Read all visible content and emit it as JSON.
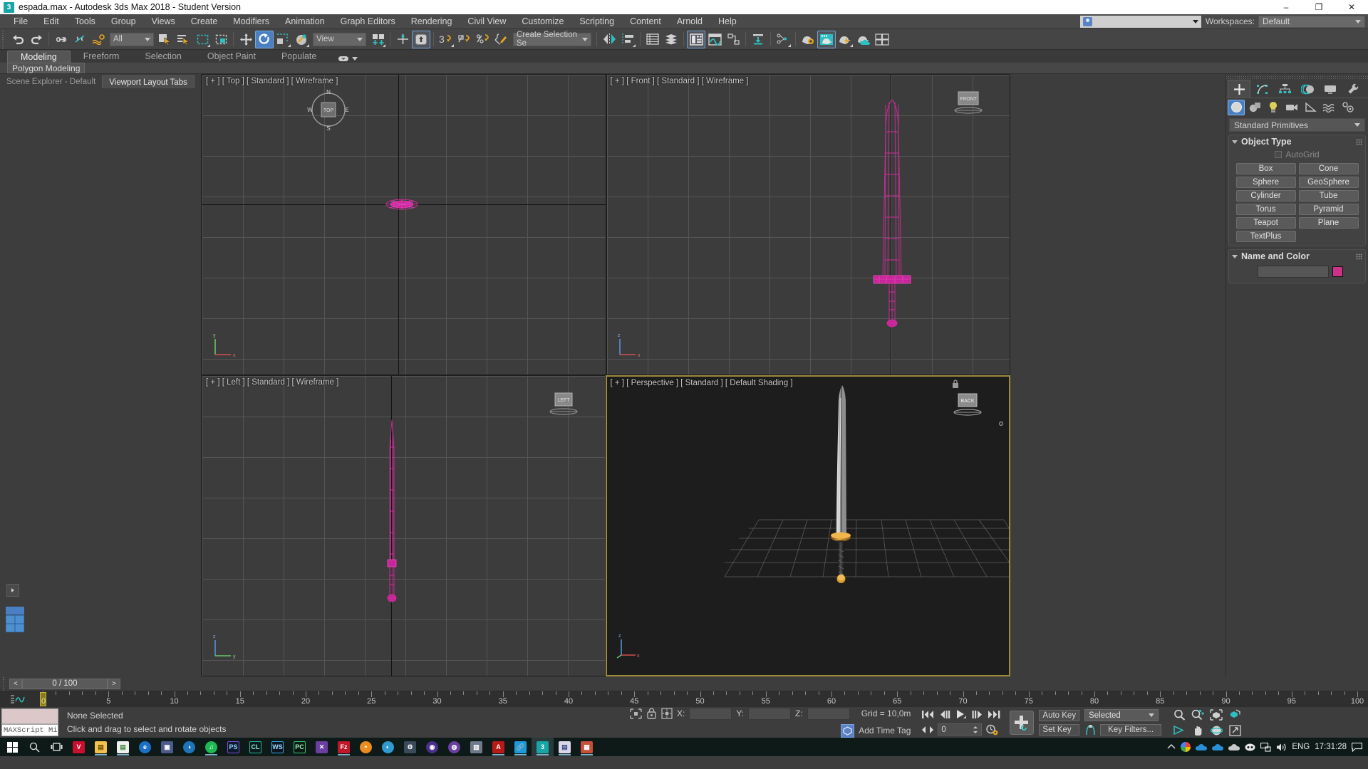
{
  "titlebar": {
    "icon": "max-app-icon",
    "title": "espada.max - Autodesk 3ds Max 2018 - Student Version",
    "minimize": "–",
    "maximize": "❐",
    "close": "✕"
  },
  "menubar": {
    "items": [
      "File",
      "Edit",
      "Tools",
      "Group",
      "Views",
      "Create",
      "Modifiers",
      "Animation",
      "Graph Editors",
      "Rendering",
      "Civil View",
      "Customize",
      "Scripting",
      "Content",
      "Arnold",
      "Help"
    ],
    "workspaces_label": "Workspaces:",
    "workspaces_value": "Default"
  },
  "maintoolbar": {
    "selection_filter": "All",
    "reference_coord": "View",
    "named_selection_set": "Create Selection Se"
  },
  "ribbon": {
    "tabs": [
      "Modeling",
      "Freeform",
      "Selection",
      "Object Paint",
      "Populate"
    ],
    "selected_tab": "Modeling",
    "subtab": "Polygon Modeling"
  },
  "leftpanel": {
    "tabs": [
      "Scene Explorer - Default",
      "Viewport Layout Tabs"
    ],
    "selected_tab": "Viewport Layout Tabs"
  },
  "viewports": [
    {
      "label": "[ + ] [ Top ] [ Standard ] [ Wireframe ]",
      "name": "top",
      "active": false
    },
    {
      "label": "[ + ] [ Front ] [ Standard ] [ Wireframe ]",
      "name": "front",
      "active": false
    },
    {
      "label": "[ + ] [ Left ] [ Standard ] [ Wireframe ]",
      "name": "left",
      "active": false
    },
    {
      "label": "[ + ] [ Perspective ] [ Standard ] [ Default Shading ]",
      "name": "perspective",
      "active": true
    }
  ],
  "viewcube": {
    "front_face": "FRONT",
    "left_face": "LEFT",
    "back_face": "BACK"
  },
  "navwheel": {
    "north": "N",
    "south": "S",
    "east": "E",
    "west": "W",
    "center": "TOP"
  },
  "command_panel": {
    "tabs": [
      "create-tab",
      "modify-tab",
      "hierarchy-tab",
      "motion-tab",
      "display-tab",
      "utilities-tab"
    ],
    "selected_tab": "create-tab",
    "categories": [
      "geometry-icon",
      "shapes-icon",
      "lights-icon",
      "cameras-icon",
      "helpers-icon",
      "space-warps-icon",
      "systems-icon"
    ],
    "selected_category": "geometry-icon",
    "dropdown_value": "Standard Primitives",
    "object_type": {
      "title": "Object Type",
      "autogrid_label": "AutoGrid",
      "autogrid_checked": false,
      "buttons": [
        "Box",
        "Cone",
        "Sphere",
        "GeoSphere",
        "Cylinder",
        "Tube",
        "Torus",
        "Pyramid",
        "Teapot",
        "Plane",
        "TextPlus"
      ]
    },
    "name_and_color": {
      "title": "Name and Color",
      "name_value": "",
      "color_hex": "#cc3388"
    }
  },
  "timeline": {
    "frame_display": "0 / 100",
    "prev_label": "<",
    "next_label": ">",
    "ticks": [
      0,
      5,
      10,
      15,
      20,
      25,
      30,
      35,
      40,
      45,
      50,
      55,
      60,
      65,
      70,
      75,
      80,
      85,
      90,
      95,
      100
    ],
    "current_frame": 0
  },
  "statusbar": {
    "maxscript_listener_label": "MAXScript Mi",
    "selection_status": "None Selected",
    "prompt": "Click and drag to select and rotate objects",
    "x_label": "X:",
    "y_label": "Y:",
    "z_label": "Z:",
    "x_value": "",
    "y_value": "",
    "z_value": "",
    "grid_label": "Grid = 10,0m",
    "add_time_tag": "Add Time Tag",
    "auto_key": "Auto Key",
    "set_key": "Set Key",
    "key_filters": "Key Filters...",
    "key_mode_value": "Selected",
    "frame_spinner_value": "0"
  },
  "taskbar": {
    "icons": [
      "start-icon",
      "search-icon",
      "task-view-icon",
      "vegas-icon",
      "file-explorer-icon",
      "notes-icon",
      "edge-icon",
      "store-icon",
      "blender-icon",
      "spotify-icon",
      "photoshop-icon",
      "corel-icon",
      "websharp-icon",
      "pc-icon",
      "visual-studio-icon",
      "filezilla-icon",
      "blender2-icon",
      "krita-icon",
      "chrome2-icon",
      "opera-icon",
      "unity-icon",
      "monitor-icon",
      "acrobat-icon",
      "link-icon",
      "max-icon",
      "office-icon",
      "apps-icon"
    ],
    "tray": [
      "chevron-up-icon",
      "chrome-icon",
      "onedrive-icon",
      "onedrive2-icon",
      "cloud-icon",
      "discord-icon",
      "network-icon",
      "volume-icon"
    ],
    "language": "ENG",
    "time": "17:31:28",
    "notification": "notification-icon"
  }
}
